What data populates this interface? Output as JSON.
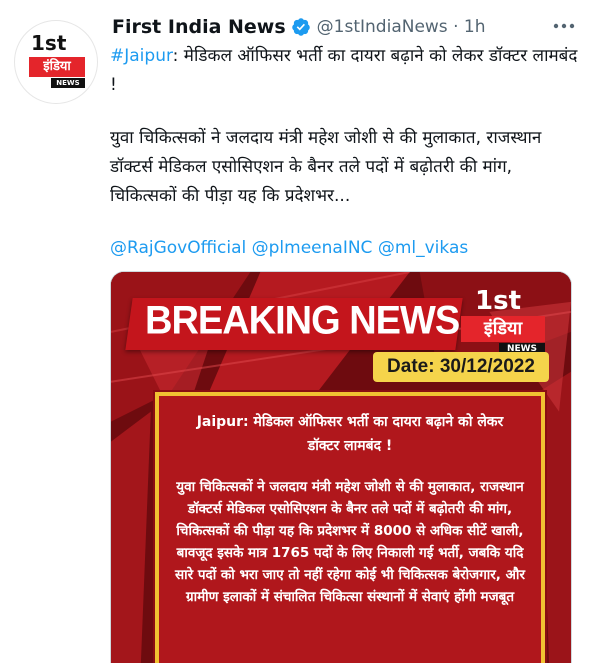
{
  "tweet": {
    "display_name": "First India News",
    "handle_time": "@1stIndiaNews · 1h",
    "avatar": {
      "top": "1st",
      "band": "इंडिया",
      "sub": "NEWS"
    },
    "hashtag": "#Jaipur",
    "headline_rest": ": मेडिकल ऑफिसर भर्ती का दायरा बढ़ाने को लेकर डॉक्टर लामबंद !",
    "paragraph": "युवा चिकित्सकों ने जलदाय मंत्री महेश जोशी से की मुलाकात, राजस्थान डॉक्टर्स मेडिकल एसोसिएशन के बैनर तले पदों में बढ़ोतरी की मांग, चिकित्सकों की पीड़ा यह कि प्रदेशभर...",
    "mentions": "@RajGovOfficial @plmeenaINC @ml_vikas"
  },
  "card": {
    "banner": "BREAKING NEWS",
    "logo": {
      "top": "1st",
      "band": "इंडिया",
      "sub": "NEWS"
    },
    "date": "Date: 30/12/2022",
    "box_headline": "Jaipur: मेडिकल ऑफिसर भर्ती का दायरा बढ़ाने को लेकर डॉक्टर लामबंद !",
    "box_body": "युवा चिकित्सकों ने जलदाय मंत्री महेश जोशी से की मुलाकात, राजस्थान डॉक्टर्स मेडिकल एसोसिएशन के बैनर तले पदों में बढ़ोतरी की मांग, चिकित्सकों की पीड़ा यह कि प्रदेशभर में 8000 से अधिक सीटें खाली, बावजूद इसके मात्र 1765 पदों के लिए निकाली गई भर्ती, जबकि यदि सारे पदों को भरा जाए तो नहीं रहेगा कोई भी चिकित्सक बेरोजगार, और ग्रामीण इलाकों में संचालित चिकित्सा संस्थानों में सेवाएं होंगी मजबूत"
  },
  "icons": {
    "verified": "verified-badge-icon",
    "more": "more-options-icon"
  },
  "colors": {
    "link": "#1d9bf0",
    "verified": "#1d9bf0",
    "brand_red": "#e4252b",
    "date_yellow": "#f5d44b"
  }
}
